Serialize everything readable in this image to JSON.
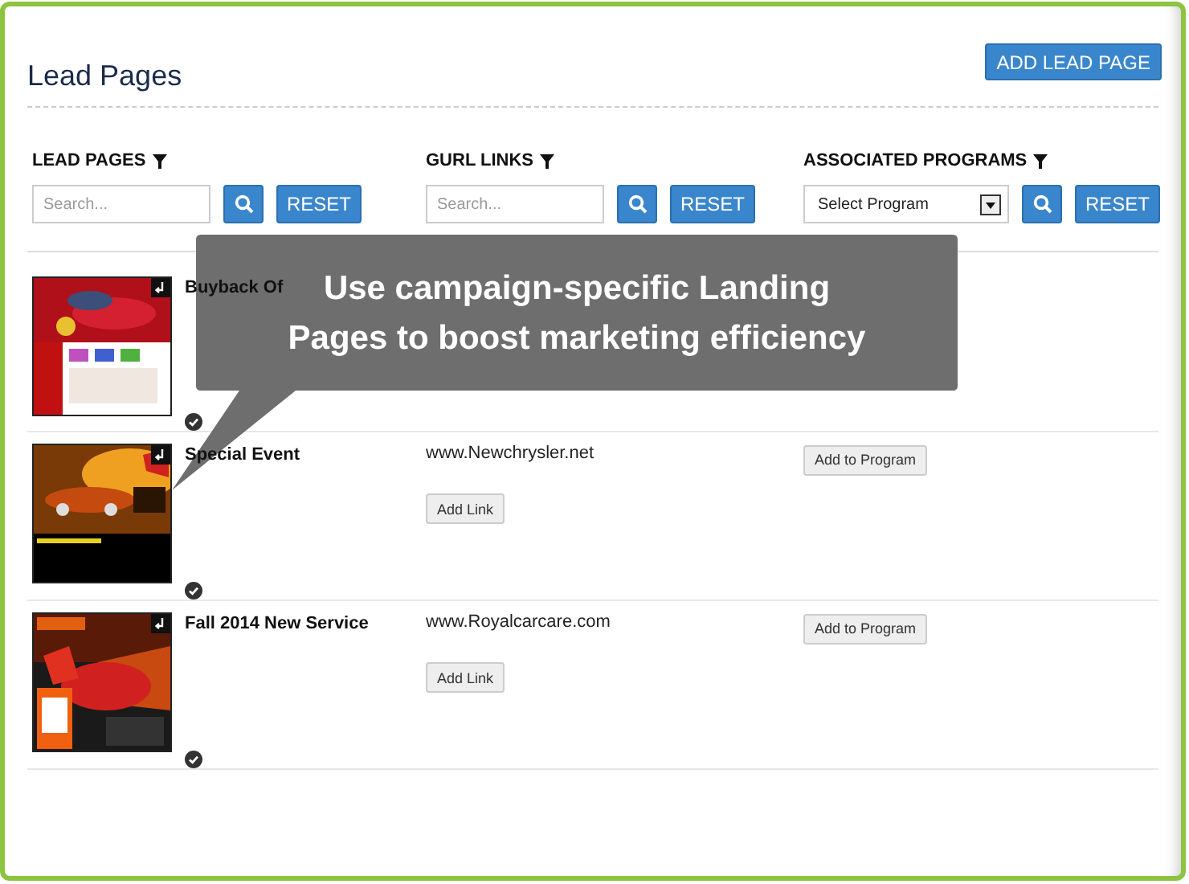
{
  "header": {
    "title": "Lead Pages",
    "add_button": "ADD LEAD PAGE"
  },
  "filters": [
    {
      "kind": "search",
      "label": "LEAD PAGES",
      "placeholder": "Search...",
      "reset": "RESET"
    },
    {
      "kind": "search",
      "label": "GURL LINKS",
      "placeholder": "Search...",
      "reset": "RESET"
    },
    {
      "kind": "select",
      "label": "ASSOCIATED PROGRAMS",
      "value": "Select Program",
      "reset": "RESET"
    }
  ],
  "rows": [
    {
      "title": "Buyback Of"
    },
    {
      "title": "Special Event",
      "link": "www.Newchrysler.net",
      "link_button": "Add Link",
      "program_button": "Add to Program"
    },
    {
      "title": "Fall 2014 New Service",
      "link": "www.Royalcarcare.com",
      "link_button": "Add Link",
      "program_button": "Add to Program"
    }
  ],
  "callout": {
    "text": "Use campaign-specific Landing Pages to boost marketing efficiency"
  }
}
